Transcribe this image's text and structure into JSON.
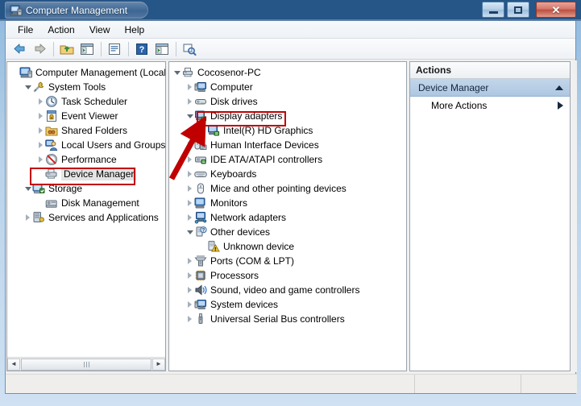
{
  "window": {
    "title": "Computer Management",
    "title_icon": "computer-management-icon",
    "minimize_label": "–",
    "maximize_label": "□",
    "close_label": "✕"
  },
  "menubar": {
    "items": [
      {
        "label": "File"
      },
      {
        "label": "Action"
      },
      {
        "label": "View"
      },
      {
        "label": "Help"
      }
    ]
  },
  "toolbar": {
    "buttons": [
      {
        "name": "back-icon",
        "glyph": "⇐"
      },
      {
        "name": "forward-icon",
        "glyph": "⇒"
      },
      {
        "name": "up-one-level-icon",
        "glyph": "⬆"
      },
      {
        "name": "show-hide-tree-icon",
        "glyph": "▤"
      },
      {
        "name": "properties-icon",
        "glyph": "▥"
      },
      {
        "name": "help-icon",
        "glyph": "?"
      },
      {
        "name": "scan-for-changes-icon",
        "glyph": "▶"
      },
      {
        "name": "update-driver-icon",
        "glyph": "⊞"
      }
    ]
  },
  "left_tree": {
    "nodes": [
      {
        "label": "Computer Management (Local",
        "indent": 0,
        "state": "root",
        "icon": "computer-management-icon"
      },
      {
        "label": "System Tools",
        "indent": 1,
        "state": "expanded",
        "icon": "system-tools-icon"
      },
      {
        "label": "Task Scheduler",
        "indent": 2,
        "state": "collapsed",
        "icon": "task-scheduler-icon"
      },
      {
        "label": "Event Viewer",
        "indent": 2,
        "state": "collapsed",
        "icon": "event-viewer-icon"
      },
      {
        "label": "Shared Folders",
        "indent": 2,
        "state": "collapsed",
        "icon": "shared-folders-icon"
      },
      {
        "label": "Local Users and Groups",
        "indent": 2,
        "state": "collapsed",
        "icon": "local-users-groups-icon"
      },
      {
        "label": "Performance",
        "indent": 2,
        "state": "collapsed",
        "icon": "performance-icon"
      },
      {
        "label": "Device Manager",
        "indent": 2,
        "state": "leaf",
        "icon": "device-manager-icon",
        "selected": true
      },
      {
        "label": "Storage",
        "indent": 1,
        "state": "expanded",
        "icon": "storage-icon"
      },
      {
        "label": "Disk Management",
        "indent": 2,
        "state": "leaf",
        "icon": "disk-management-icon"
      },
      {
        "label": "Services and Applications",
        "indent": 1,
        "state": "collapsed",
        "icon": "services-applications-icon"
      }
    ],
    "scrollbar": {
      "left_arrow": "◄",
      "right_arrow": "►"
    }
  },
  "center_tree": {
    "nodes": [
      {
        "label": "Cocosenor-PC",
        "indent": 0,
        "state": "expanded",
        "icon": "computer-root-icon"
      },
      {
        "label": "Computer",
        "indent": 1,
        "state": "collapsed",
        "icon": "computer-icon"
      },
      {
        "label": "Disk drives",
        "indent": 1,
        "state": "collapsed",
        "icon": "disk-drive-icon"
      },
      {
        "label": "Display adapters",
        "indent": 1,
        "state": "expanded",
        "icon": "display-adapter-icon",
        "highlighted": true
      },
      {
        "label": "Intel(R) HD Graphics",
        "indent": 2,
        "state": "leaf",
        "icon": "display-adapter-icon"
      },
      {
        "label": "Human Interface Devices",
        "indent": 1,
        "state": "collapsed",
        "icon": "hid-icon"
      },
      {
        "label": "IDE ATA/ATAPI controllers",
        "indent": 1,
        "state": "collapsed",
        "icon": "ide-controller-icon"
      },
      {
        "label": "Keyboards",
        "indent": 1,
        "state": "collapsed",
        "icon": "keyboard-icon"
      },
      {
        "label": "Mice and other pointing devices",
        "indent": 1,
        "state": "collapsed",
        "icon": "mouse-icon"
      },
      {
        "label": "Monitors",
        "indent": 1,
        "state": "collapsed",
        "icon": "monitor-icon"
      },
      {
        "label": "Network adapters",
        "indent": 1,
        "state": "collapsed",
        "icon": "network-adapter-icon"
      },
      {
        "label": "Other devices",
        "indent": 1,
        "state": "expanded",
        "icon": "other-device-icon"
      },
      {
        "label": "Unknown device",
        "indent": 2,
        "state": "leaf",
        "icon": "unknown-device-warning-icon"
      },
      {
        "label": "Ports (COM & LPT)",
        "indent": 1,
        "state": "collapsed",
        "icon": "port-icon"
      },
      {
        "label": "Processors",
        "indent": 1,
        "state": "collapsed",
        "icon": "processor-icon"
      },
      {
        "label": "Sound, video and game controllers",
        "indent": 1,
        "state": "collapsed",
        "icon": "sound-controller-icon"
      },
      {
        "label": "System devices",
        "indent": 1,
        "state": "collapsed",
        "icon": "system-device-icon"
      },
      {
        "label": "Universal Serial Bus controllers",
        "indent": 1,
        "state": "collapsed",
        "icon": "usb-controller-icon"
      }
    ]
  },
  "actions_pane": {
    "header": "Actions",
    "group_title": "Device Manager",
    "group_collapse_icon": "caret-up-icon",
    "items": [
      {
        "label": "More Actions",
        "submenu_icon": "caret-right-icon"
      }
    ]
  },
  "annotations": {
    "red_box_left": "Device Manager",
    "red_box_center": "Display adapters",
    "arrow_color": "#c00000"
  },
  "colors": {
    "titlebar": "#265587",
    "annotation_red": "#c00000",
    "actions_group": "#aec7e2",
    "selection_gray": "#e4e4e4"
  }
}
